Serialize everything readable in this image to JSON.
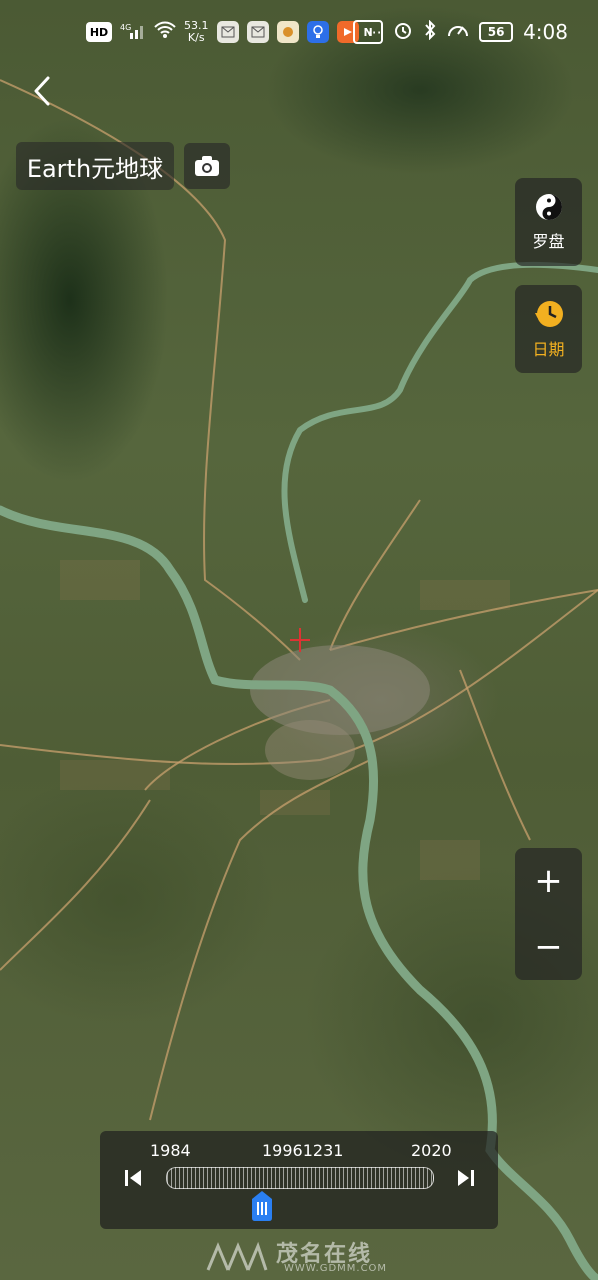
{
  "status_bar": {
    "hd": "HD",
    "network": "4G",
    "speed_value": "53.1",
    "speed_unit": "K/s",
    "battery": "56",
    "time": "4:08",
    "more": "···",
    "nfc": "N"
  },
  "header": {
    "title": "Earth元地球"
  },
  "controls": {
    "compass_label": "罗盘",
    "date_label": "日期",
    "zoom_in": "+",
    "zoom_out": "−"
  },
  "timeline": {
    "start_year": "1984",
    "current": "19961231",
    "end_year": "2020",
    "position_fraction": 0.36
  },
  "watermark": {
    "main": "茂名在线",
    "sub": "WWW.GDMM.COM"
  },
  "colors": {
    "accent": "#f2b020",
    "handle": "#2a7ff2"
  }
}
